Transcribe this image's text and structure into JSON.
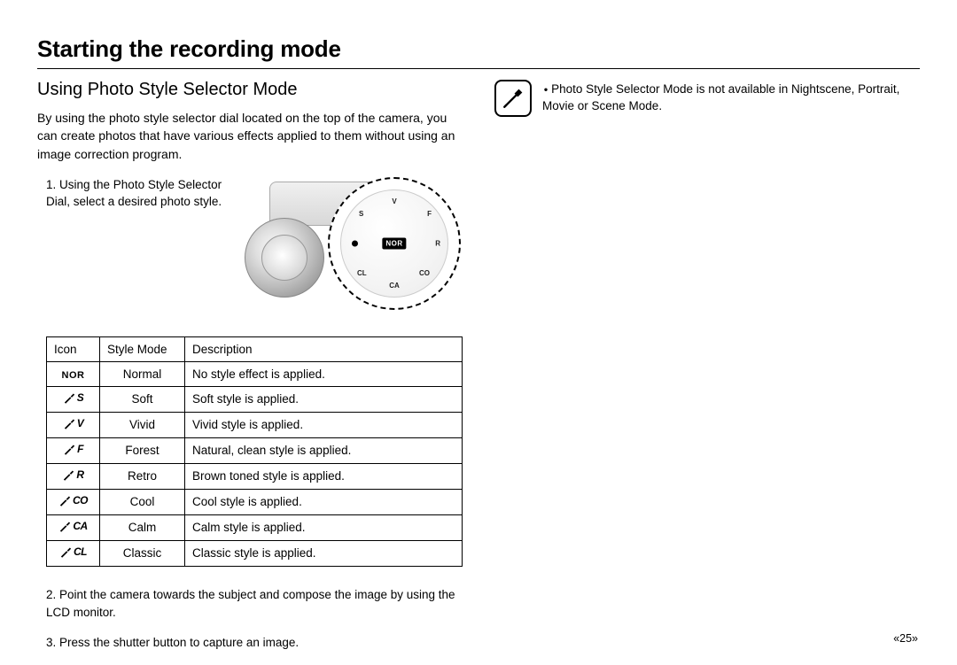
{
  "header": {
    "title": "Starting the recording mode"
  },
  "left": {
    "subtitle": "Using Photo Style Selector Mode",
    "intro": "By using the photo style selector dial located on the top of the camera, you can create photos that have various effects applied to them without using an image correction program.",
    "step1": "1. Using the Photo Style Selector Dial, select a desired photo style.",
    "dial_label": "NOR",
    "table": {
      "headers": {
        "icon": "Icon",
        "mode": "Style Mode",
        "desc": "Description"
      },
      "rows": [
        {
          "icon_text": "NOR",
          "icon_type": "nor",
          "mode": "Normal",
          "desc": "No style effect is applied."
        },
        {
          "icon_text": "S",
          "icon_type": "brush",
          "mode": "Soft",
          "desc": "Soft style is applied."
        },
        {
          "icon_text": "V",
          "icon_type": "brush",
          "mode": "Vivid",
          "desc": "Vivid style is applied."
        },
        {
          "icon_text": "F",
          "icon_type": "brush",
          "mode": "Forest",
          "desc": "Natural, clean style is applied."
        },
        {
          "icon_text": "R",
          "icon_type": "brush",
          "mode": "Retro",
          "desc": "Brown toned style is applied."
        },
        {
          "icon_text": "CO",
          "icon_type": "brush",
          "mode": "Cool",
          "desc": "Cool style is applied."
        },
        {
          "icon_text": "CA",
          "icon_type": "brush",
          "mode": "Calm",
          "desc": "Calm style is applied."
        },
        {
          "icon_text": "CL",
          "icon_type": "brush",
          "mode": "Classic",
          "desc": "Classic style is applied."
        }
      ]
    },
    "step2": "2. Point the camera towards the subject and compose the image by using the LCD monitor.",
    "step3": "3. Press the shutter button to capture an image."
  },
  "right": {
    "note": "Photo Style Selector Mode is not available in Nightscene, Portrait, Movie or Scene Mode."
  },
  "page_number": "«25»"
}
